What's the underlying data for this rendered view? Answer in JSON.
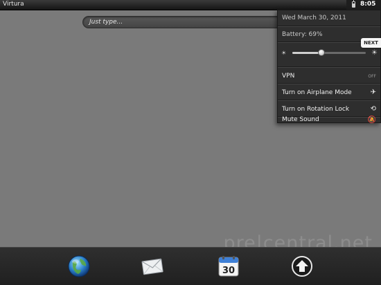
{
  "status_bar": {
    "carrier": "Virtura",
    "time": "8:05"
  },
  "search": {
    "placeholder": "Just type..."
  },
  "menu": {
    "date": "Wed March 30, 2011",
    "battery": "Battery: 69%",
    "brightness_level": 0.4,
    "items": {
      "vpn": {
        "label": "VPN",
        "state": "OFF"
      },
      "airplane": {
        "label": "Turn on Airplane Mode",
        "icon": "airplane-icon"
      },
      "rotation": {
        "label": "Turn on Rotation Lock",
        "icon": "rotation-lock-icon"
      },
      "mute": {
        "label": "Mute Sound",
        "icon": "mute-icon"
      }
    }
  },
  "next_badge": "NEXT",
  "watermark": "pre|central.net",
  "dock": {
    "apps": [
      {
        "name": "Web",
        "icon": "globe-icon"
      },
      {
        "name": "Email",
        "icon": "envelope-icon"
      },
      {
        "name": "Calendar",
        "icon": "calendar-icon",
        "day": "30"
      },
      {
        "name": "Launcher",
        "icon": "launcher-arrow-icon"
      }
    ]
  }
}
